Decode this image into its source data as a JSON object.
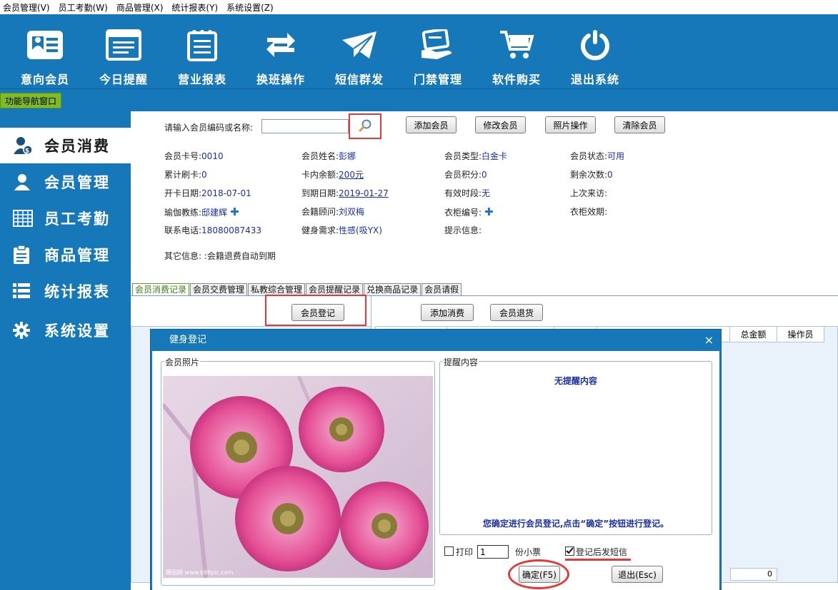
{
  "menu": [
    "会员管理(V)",
    "员工考勤(W)",
    "商品管理(X)",
    "统计报表(Y)",
    "系统设置(Z)"
  ],
  "toolbar": [
    {
      "label": "意向会员",
      "icon": "id-card-icon"
    },
    {
      "label": "今日提醒",
      "icon": "browser-list-icon"
    },
    {
      "label": "营业报表",
      "icon": "notepad-icon"
    },
    {
      "label": "换班操作",
      "icon": "swap-arrows-icon"
    },
    {
      "label": "短信群发",
      "icon": "envelope-icon"
    },
    {
      "label": "门禁管理",
      "icon": "card-hand-icon"
    },
    {
      "label": "软件购买",
      "icon": "shopping-cart-icon"
    },
    {
      "label": "退出系统",
      "icon": "power-icon"
    }
  ],
  "nav_tab": "功能导航窗口",
  "sidebar": [
    {
      "label": "会员消费",
      "icon": "member-pay-icon"
    },
    {
      "label": "会员管理",
      "icon": "person-icon"
    },
    {
      "label": "员工考勤",
      "icon": "calendar-grid-icon"
    },
    {
      "label": "商品管理",
      "icon": "clipboard-icon"
    },
    {
      "label": "统计报表",
      "icon": "list-icon"
    },
    {
      "label": "系统设置",
      "icon": "gear-icon"
    }
  ],
  "search": {
    "label": "请输入会员编码或名称:",
    "value": ""
  },
  "buttons": {
    "add": "添加会员",
    "edit": "修改会员",
    "photo": "照片操作",
    "clear": "清除会员"
  },
  "info": {
    "card_no_l": "会员卡号:",
    "card_no": "0010",
    "name_l": "会员姓名:",
    "name": "彭娜",
    "type_l": "会员类型:",
    "type": "白金卡",
    "status_l": "会员状态:",
    "status": "可用",
    "swipes_l": "累计刷卡:",
    "swipes": "0",
    "balance_l": "卡内余额:",
    "balance": "200元",
    "points_l": "会员积分:",
    "points": "0",
    "remaining_l": "剩余次数:",
    "remaining": "0",
    "open_l": "开卡日期:",
    "open": "2018-07-01",
    "expire_l": "到期日期:",
    "expire": "2019-01-27",
    "period_l": "有效时段:",
    "period": "无",
    "last_l": "上次来访:",
    "last": "",
    "coach_l": "瑜伽教练:",
    "coach": "邸建辉",
    "advisor_l": "会籍顾问:",
    "advisor": "刘双梅",
    "locker_l": "衣柜编号:",
    "locker": "",
    "locker_exp_l": "衣柜效期:",
    "locker_exp": "",
    "phone_l": "联系电话:",
    "phone": "18080087433",
    "need_l": "健身需求:",
    "need": "性感(吸YX)",
    "tip_l": "提示信息:",
    "tip": "",
    "other_l": "其它信息:",
    "other": ":会籍退费自动到期"
  },
  "tabs": [
    "会员消费记录",
    "会员交费管理",
    "私教综合管理",
    "会员提醒记录",
    "兑换商品记录",
    "会员请假"
  ],
  "panel_buttons": {
    "register": "会员登记",
    "add_consume": "添加消费",
    "return_goods": "会员退货"
  },
  "grid": {
    "col_total": "总金额",
    "col_operator": "操作员",
    "total_value": "0"
  },
  "dialog": {
    "title": "健身登记",
    "close": "×",
    "photo_group": "会员照片",
    "photo_watermark": "摄图网 www.699pic.com",
    "remind_group": "提醒内容",
    "remind_text": "无提醒内容",
    "confirm_text": "您确定进行会员登记,点击“确定”按钮进行登记。",
    "print_label": "打印",
    "copies_value": "1",
    "copies_suffix": "份小票",
    "sms_label": "登记后发短信",
    "ok": "确定(F5)",
    "exit": "退出(Esc)"
  },
  "colors": {
    "brand": "#1678b8",
    "nav_green": "#7fba29",
    "highlight_red": "#e23a3a",
    "value_blue": "#1a2fa8"
  }
}
